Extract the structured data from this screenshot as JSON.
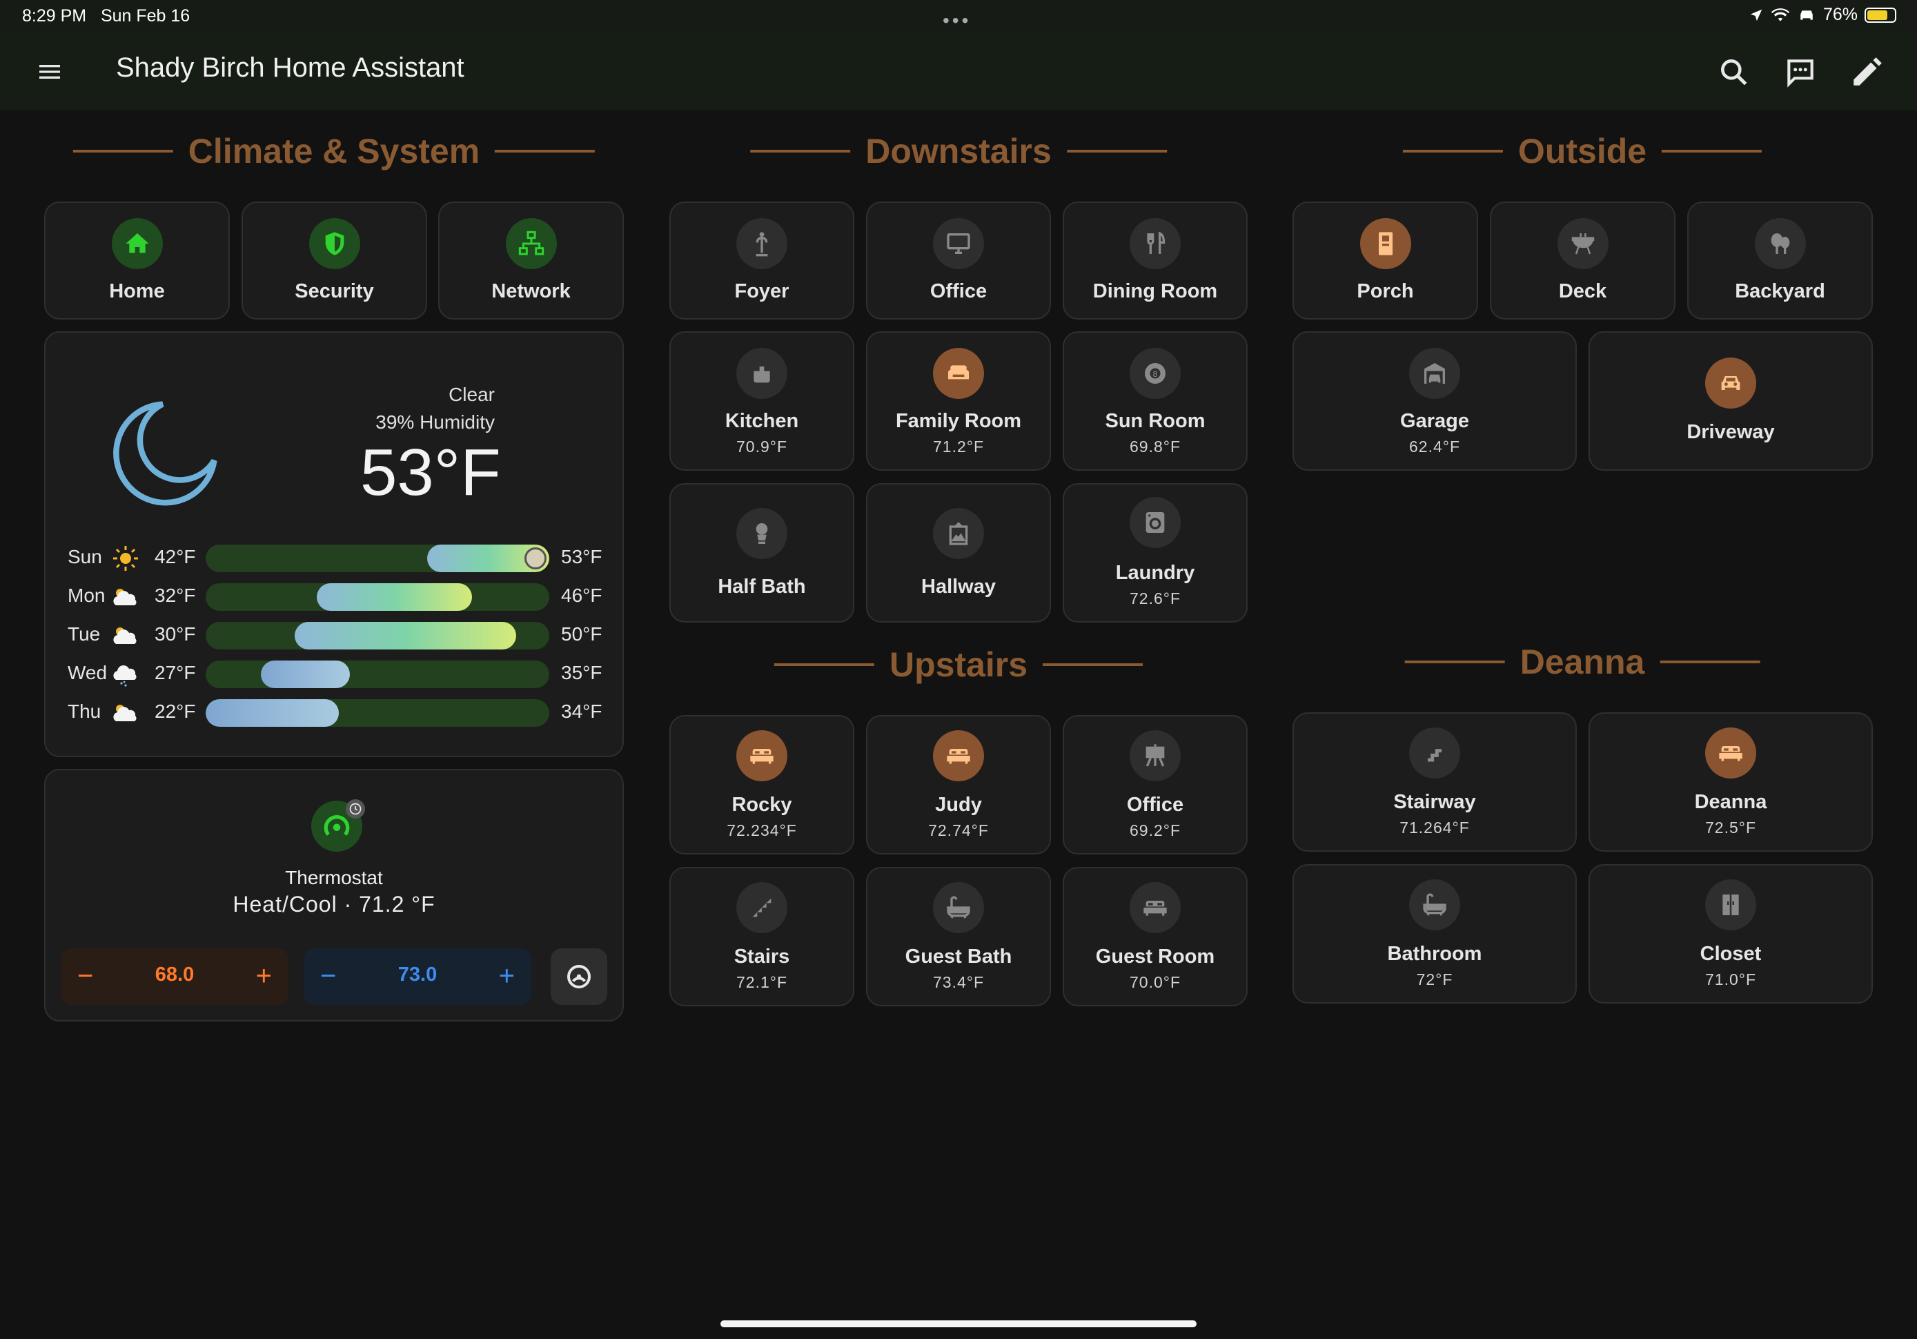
{
  "status_bar": {
    "time": "8:29 PM",
    "date": "Sun Feb 16",
    "battery": "76%"
  },
  "app": {
    "title": "Shady Birch Home Assistant",
    "icons": [
      "menu-icon",
      "search-icon",
      "chat-icon",
      "edit-pencil-icon"
    ]
  },
  "sections": {
    "climate": "Climate & System",
    "downstairs": "Downstairs",
    "outside": "Outside",
    "upstairs": "Upstairs",
    "deanna": "Deanna"
  },
  "climate_tiles": [
    {
      "name": "Home",
      "icon": "home-icon"
    },
    {
      "name": "Security",
      "icon": "shield-icon"
    },
    {
      "name": "Network",
      "icon": "network-icon"
    }
  ],
  "weather": {
    "condition": "Clear",
    "humidity": "39% Humidity",
    "temperature": "53°F",
    "icon": "moon-icon",
    "forecast": [
      {
        "day": "Sun",
        "icon": "sun-icon",
        "low": "42°F",
        "high": "53°F",
        "range_lo": 42,
        "range_hi": 53
      },
      {
        "day": "Mon",
        "icon": "cloud-icon",
        "low": "32°F",
        "high": "46°F",
        "range_lo": 32,
        "range_hi": 46
      },
      {
        "day": "Tue",
        "icon": "cloud-icon",
        "low": "30°F",
        "high": "50°F",
        "range_lo": 30,
        "range_hi": 50
      },
      {
        "day": "Wed",
        "icon": "snow-cloud-icon",
        "low": "27°F",
        "high": "35°F",
        "range_lo": 27,
        "range_hi": 35
      },
      {
        "day": "Thu",
        "icon": "cloud-icon",
        "low": "22°F",
        "high": "34°F",
        "range_lo": 22,
        "range_hi": 34
      }
    ],
    "scale_min": 22,
    "scale_max": 53,
    "current": 53
  },
  "thermostat": {
    "name": "Thermostat",
    "state": "Heat/Cool · 71.2 °F",
    "heat_setpoint": "68.0",
    "cool_setpoint": "73.0",
    "minus": "−",
    "plus": "+"
  },
  "downstairs": [
    {
      "name": "Foyer",
      "temp": "",
      "icon": "coat-rack-icon",
      "active": false
    },
    {
      "name": "Office",
      "temp": "",
      "icon": "monitor-icon",
      "active": false
    },
    {
      "name": "Dining Room",
      "temp": "",
      "icon": "silverware-icon",
      "active": false
    },
    {
      "name": "Kitchen",
      "temp": "70.9°F",
      "icon": "pot-icon",
      "active": false
    },
    {
      "name": "Family Room",
      "temp": "71.2°F",
      "icon": "sofa-icon",
      "active": true
    },
    {
      "name": "Sun Room",
      "temp": "69.8°F",
      "icon": "billiards-icon",
      "active": false
    },
    {
      "name": "Half Bath",
      "temp": "",
      "icon": "toilet-icon",
      "active": false
    },
    {
      "name": "Hallway",
      "temp": "",
      "icon": "picture-frame-icon",
      "active": false
    },
    {
      "name": "Laundry",
      "temp": "72.6°F",
      "icon": "washing-machine-icon",
      "active": false
    }
  ],
  "outside": [
    {
      "name": "Porch",
      "temp": "",
      "icon": "door-icon",
      "active": true
    },
    {
      "name": "Deck",
      "temp": "",
      "icon": "grill-icon",
      "active": false
    },
    {
      "name": "Backyard",
      "temp": "",
      "icon": "tree-icon",
      "active": false
    },
    {
      "name": "Garage",
      "temp": "62.4°F",
      "icon": "garage-icon",
      "active": false
    },
    {
      "name": "Driveway",
      "temp": "",
      "icon": "car-icon",
      "active": true
    }
  ],
  "upstairs": [
    {
      "name": "Rocky",
      "temp": "72.234°F",
      "icon": "bed-icon",
      "active": true
    },
    {
      "name": "Judy",
      "temp": "72.74°F",
      "icon": "bed-icon",
      "active": true
    },
    {
      "name": "Office",
      "temp": "69.2°F",
      "icon": "easel-icon",
      "active": false
    },
    {
      "name": "Stairs",
      "temp": "72.1°F",
      "icon": "stairs-icon",
      "active": false
    },
    {
      "name": "Guest Bath",
      "temp": "73.4°F",
      "icon": "bathtub-icon",
      "active": false
    },
    {
      "name": "Guest Room",
      "temp": "70.0°F",
      "icon": "bed-icon",
      "active": false
    }
  ],
  "deanna": [
    {
      "name": "Stairway",
      "temp": "71.264°F",
      "icon": "stairs-icon",
      "active": false
    },
    {
      "name": "Deanna",
      "temp": "72.5°F",
      "icon": "bed-icon",
      "active": true
    },
    {
      "name": "Bathroom",
      "temp": "72°F",
      "icon": "bathtub-icon",
      "active": false
    },
    {
      "name": "Closet",
      "temp": "71.0°F",
      "icon": "wardrobe-icon",
      "active": false
    }
  ],
  "colors": {
    "background": "#121212",
    "header_accent": "#8a5a32",
    "tile_bg": "#1c1c1c",
    "active_icon_bg": "#8a5430",
    "active_icon_fg": "#ffc38a",
    "green_icon_fg": "#2fd22f",
    "heat": "#ff7a2a",
    "cool": "#3a8ef0"
  }
}
